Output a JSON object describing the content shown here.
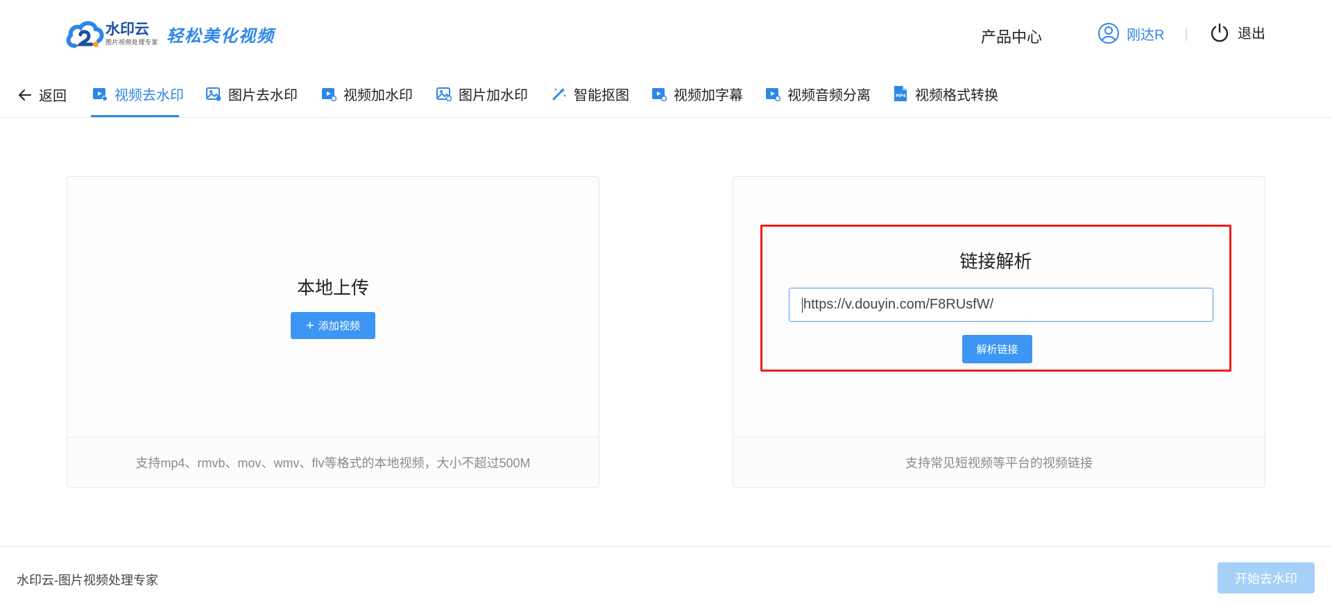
{
  "header": {
    "logo_main": "水印云",
    "logo_sub": "图片视频处理专家",
    "logo_slogan": "轻松美化视频",
    "product_center": "产品中心",
    "username": "刚达R",
    "logout": "退出"
  },
  "tabs": {
    "back": "返回",
    "items": [
      {
        "label": "视频去水印",
        "icon": "video-icon",
        "active": true
      },
      {
        "label": "图片去水印",
        "icon": "image-icon"
      },
      {
        "label": "视频加水印",
        "icon": "video-add-icon"
      },
      {
        "label": "图片加水印",
        "icon": "image-add-icon"
      },
      {
        "label": "智能抠图",
        "icon": "magic-wand-icon"
      },
      {
        "label": "视频加字幕",
        "icon": "video-subtitle-icon"
      },
      {
        "label": "视频音频分离",
        "icon": "video-audio-icon"
      },
      {
        "label": "视频格式转换",
        "icon": "mp4-file-icon"
      }
    ]
  },
  "local_upload": {
    "title": "本地上传",
    "button": "添加视频",
    "footer": "支持mp4、rmvb、mov、wmv、flv等格式的本地视频，大小不超过500M"
  },
  "link_parse": {
    "title": "链接解析",
    "input_value": "https://v.douyin.com/F8RUsfW/",
    "button": "解析链接",
    "footer": "支持常见短视频等平台的视频链接"
  },
  "bottom": {
    "text": "水印云-图片视频处理专家",
    "start_button": "开始去水印"
  },
  "colors": {
    "accent": "#2d86e8",
    "button": "#3d96f3",
    "button_disabled": "#a6d0f8",
    "highlight_border": "#ee1c1c"
  }
}
